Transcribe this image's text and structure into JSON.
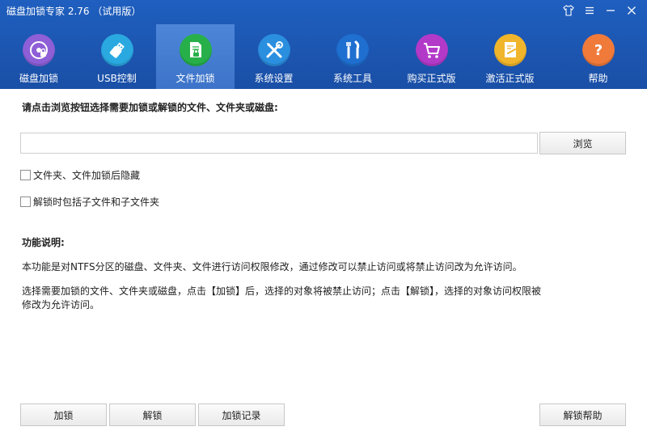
{
  "window": {
    "title": "磁盘加锁专家 2.76  （试用版）"
  },
  "nav": {
    "items": [
      {
        "label": "磁盘加锁",
        "icon": "disk-lock-icon",
        "color": "#8e5fd6"
      },
      {
        "label": "USB控制",
        "icon": "usb-icon",
        "color": "#2aa8e0"
      },
      {
        "label": "文件加锁",
        "icon": "file-lock-icon",
        "color": "#27b04a"
      },
      {
        "label": "系统设置",
        "icon": "tools-cross-icon",
        "color": "#2b8fe0"
      },
      {
        "label": "系统工具",
        "icon": "tools-icon",
        "color": "#1f6fd1"
      },
      {
        "label": "购买正式版",
        "icon": "cart-icon",
        "color": "#b33ac9"
      },
      {
        "label": "激活正式版",
        "icon": "activate-icon",
        "color": "#f0b52a"
      },
      {
        "label": "帮助",
        "icon": "help-icon",
        "color": "#f07a3a"
      }
    ]
  },
  "main": {
    "prompt": "请点击浏览按钮选择需要加锁或解锁的文件、文件夹或磁盘:",
    "path_value": "",
    "browse_label": "浏览",
    "options": [
      {
        "label": "文件夹、文件加锁后隐藏",
        "checked": false
      },
      {
        "label": "解锁时包括子文件和子文件夹",
        "checked": false
      }
    ],
    "desc_title": "功能说明:",
    "desc_p1": "本功能是对NTFS分区的磁盘、文件夹、文件进行访问权限修改，通过修改可以禁止访问或将禁止访问改为允许访问。",
    "desc_p2_line1": "选择需要加锁的文件、文件夹或磁盘，点击【加锁】后，选择的对象将被禁止访问；点击【解锁】，选择的对象访问权限被",
    "desc_p2_line2": "修改为允许访问。"
  },
  "footer": {
    "lock_label": "加锁",
    "unlock_label": "解锁",
    "log_label": "加锁记录",
    "help_label": "解锁帮助"
  },
  "colors": {
    "header": "#1f5fbf",
    "active_tab": "#4d86d9"
  }
}
